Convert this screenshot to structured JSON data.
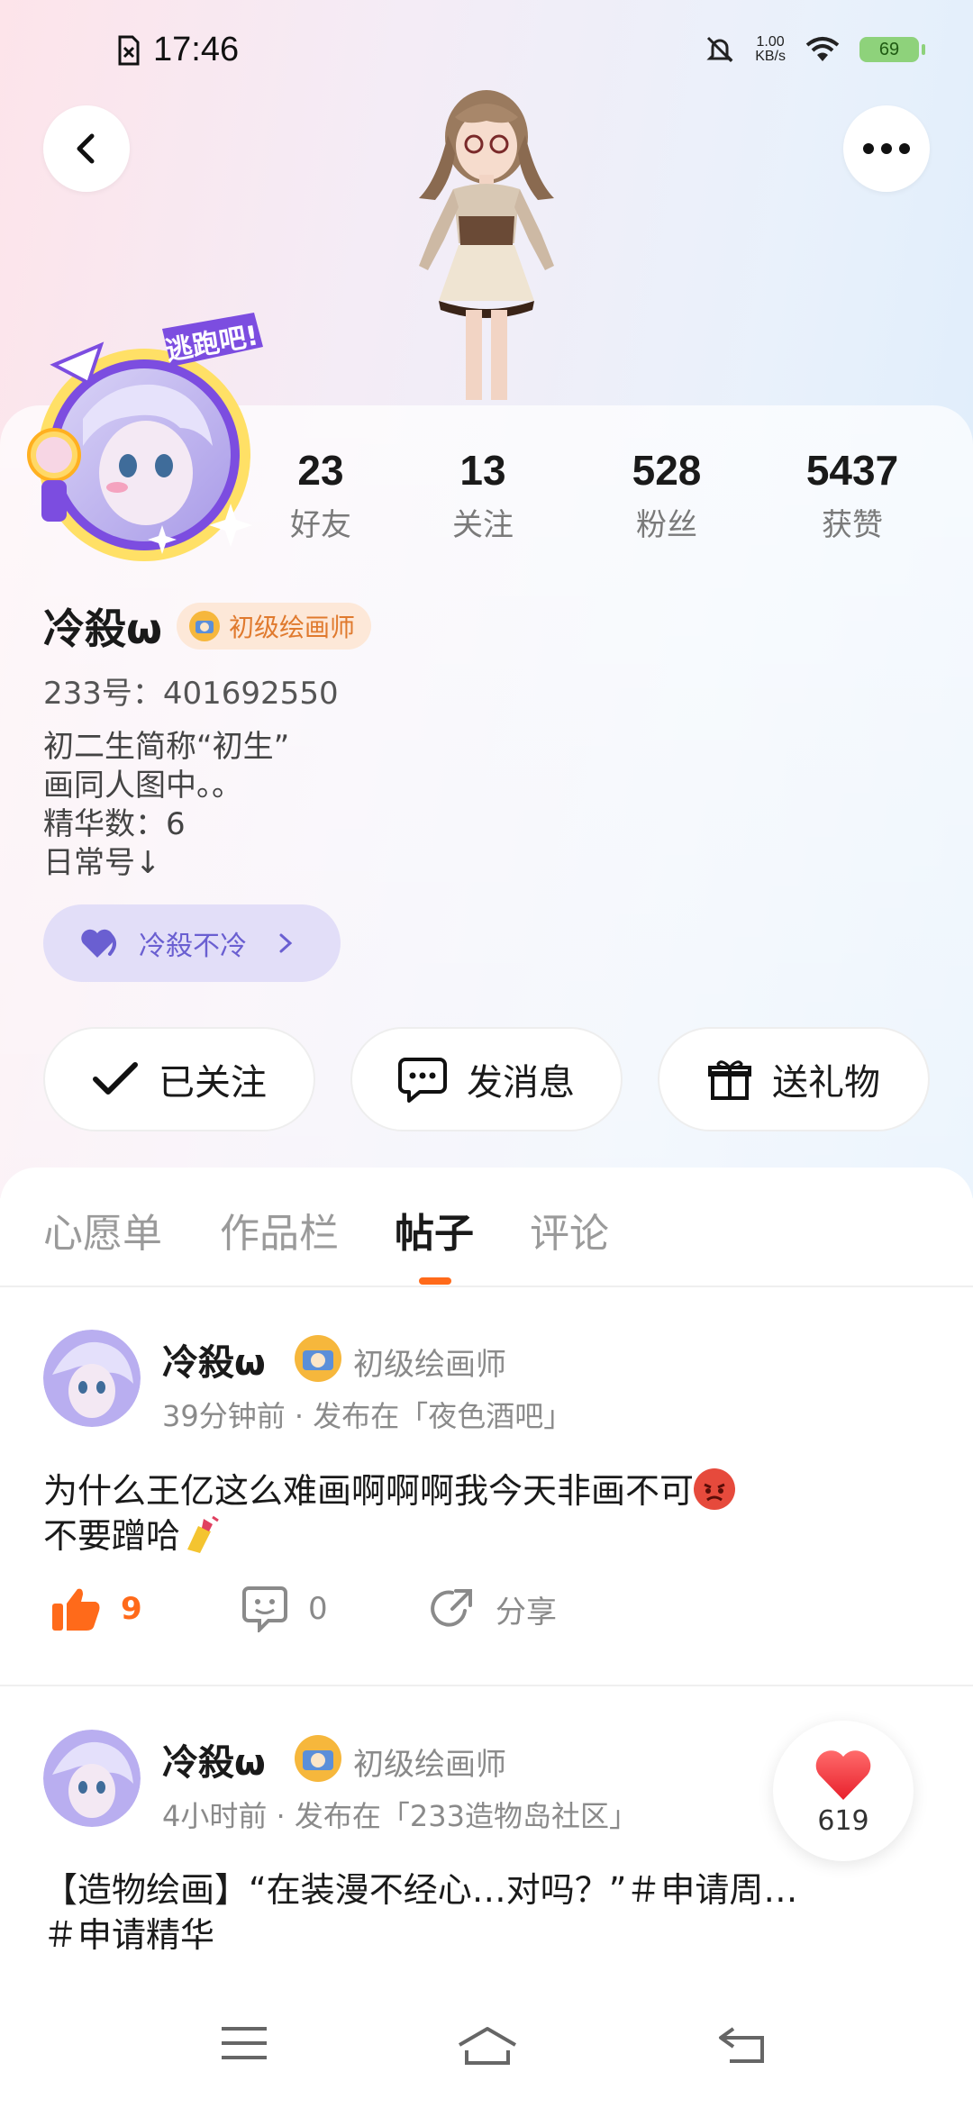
{
  "status_bar": {
    "time": "17:46",
    "net_speed_value": "1.00",
    "net_speed_unit": "KB/s",
    "battery": "69"
  },
  "header": {
    "back_icon": "chevron-left-icon",
    "more_icon": "more-horizontal-icon"
  },
  "stats": [
    {
      "value": "23",
      "label": "好友"
    },
    {
      "value": "13",
      "label": "关注"
    },
    {
      "value": "528",
      "label": "粉丝"
    },
    {
      "value": "5437",
      "label": "获赞"
    }
  ],
  "profile": {
    "name": "冷殺ω",
    "level_badge": "初级绘画师",
    "uid": "233号：401692550",
    "bio": [
      "初二生简称“初生”",
      "画同人图中。。",
      "精华数：6",
      "日常号↓"
    ],
    "pill_label": "冷殺不冷",
    "avatar_sticker": "逃跑吧!"
  },
  "actions": {
    "follow": "已关注",
    "message": "发消息",
    "gift": "送礼物"
  },
  "tabs": [
    "心愿单",
    "作品栏",
    "帖子",
    "评论"
  ],
  "active_tab": "帖子",
  "posts": [
    {
      "author": "冷殺ω",
      "level": "初级绘画师",
      "meta": "39分钟前 · 发布在「夜色酒吧」",
      "line1": "为什么王亿这么难画啊啊啊我今天非画不可",
      "line2": "不要蹭哈",
      "likes": "9",
      "comments": "0",
      "share": "分享"
    },
    {
      "author": "冷殺ω",
      "level": "初级绘画师",
      "meta": "4小时前 · 发布在「233造物岛社区」",
      "line1": "【造物绘画】“在装漫不经心…对吗？”＃申请周…",
      "line2": "＃申请精华"
    }
  ],
  "floating_like": {
    "count": "619"
  },
  "colors": {
    "accent": "#ff6a1a",
    "pill_bg": "#e2def8",
    "pill_text": "#6a5fd1",
    "badge_text": "#e07a2e"
  }
}
